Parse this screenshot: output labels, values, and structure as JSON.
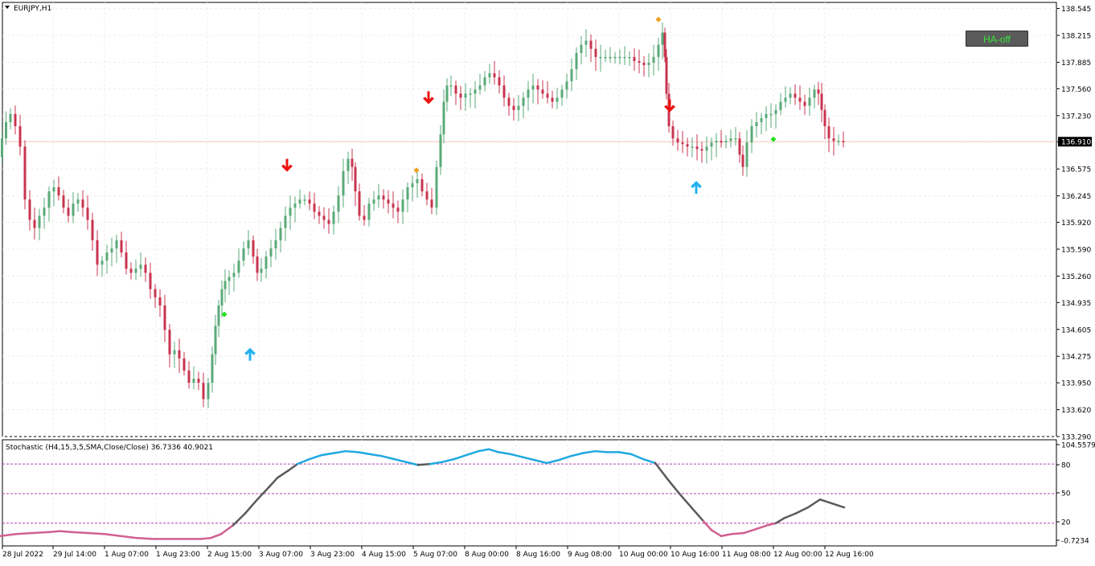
{
  "window": {
    "title": "EURJPY,H1"
  },
  "button": {
    "ha_label": "HA-off"
  },
  "colors": {
    "bull": "#5aaa78",
    "bear": "#c8344f",
    "grid": "#ececec",
    "stoch_high": "#20a8e0",
    "stoch_mid": "#5a5a5a",
    "stoch_low": "#d06090",
    "level_line": "#b040b0",
    "arrow_up": "#20b0f0",
    "arrow_down": "#ee1010",
    "dot_orange": "#f0a020",
    "dot_green": "#20e020",
    "price_marker_bg": "#000000",
    "price_marker_text": "#ffffff",
    "button_bg": "#5a5a5a",
    "button_text": "#39e639"
  },
  "chart_data": [
    {
      "type": "candlestick",
      "title": "EURJPY,H1",
      "ylim": [
        133.29,
        138.62
      ],
      "y_ticks": [
        "138.545",
        "138.215",
        "137.885",
        "137.560",
        "137.230",
        "136.910",
        "136.575",
        "136.245",
        "135.920",
        "135.590",
        "135.260",
        "134.935",
        "134.605",
        "134.275",
        "133.950",
        "133.620",
        "133.290"
      ],
      "current_price": "136.910",
      "x_ticks": [
        "28 Jul 2022",
        "29 Jul 14:00",
        "1 Aug 07:00",
        "1 Aug 23:00",
        "2 Aug 15:00",
        "3 Aug 07:00",
        "3 Aug 23:00",
        "4 Aug 15:00",
        "5 Aug 07:00",
        "8 Aug 00:00",
        "8 Aug 16:00",
        "9 Aug 08:00",
        "10 Aug 00:00",
        "10 Aug 16:00",
        "11 Aug 08:00",
        "12 Aug 00:00",
        "12 Aug 16:00"
      ],
      "close_path": [
        [
          0,
          136.72
        ],
        [
          5,
          136.95
        ],
        [
          10,
          137.15
        ],
        [
          16,
          137.25
        ],
        [
          22,
          137.1
        ],
        [
          28,
          136.85
        ],
        [
          34,
          136.2
        ],
        [
          40,
          135.95
        ],
        [
          46,
          135.85
        ],
        [
          52,
          136.0
        ],
        [
          58,
          136.1
        ],
        [
          64,
          136.3
        ],
        [
          70,
          136.35
        ],
        [
          76,
          136.25
        ],
        [
          82,
          136.1
        ],
        [
          88,
          136.0
        ],
        [
          94,
          136.15
        ],
        [
          100,
          136.2
        ],
        [
          106,
          136.1
        ],
        [
          112,
          135.95
        ],
        [
          118,
          135.7
        ],
        [
          124,
          135.4
        ],
        [
          130,
          135.45
        ],
        [
          136,
          135.55
        ],
        [
          142,
          135.6
        ],
        [
          148,
          135.7
        ],
        [
          154,
          135.55
        ],
        [
          160,
          135.35
        ],
        [
          166,
          135.3
        ],
        [
          172,
          135.35
        ],
        [
          178,
          135.4
        ],
        [
          184,
          135.3
        ],
        [
          190,
          135.1
        ],
        [
          196,
          135.0
        ],
        [
          202,
          134.9
        ],
        [
          208,
          134.6
        ],
        [
          214,
          134.3
        ],
        [
          220,
          134.35
        ],
        [
          226,
          134.25
        ],
        [
          232,
          134.1
        ],
        [
          238,
          133.95
        ],
        [
          244,
          134.0
        ],
        [
          250,
          133.95
        ],
        [
          256,
          133.75
        ],
        [
          262,
          133.95
        ],
        [
          266,
          134.3
        ],
        [
          270,
          134.65
        ],
        [
          274,
          134.9
        ],
        [
          278,
          135.1
        ],
        [
          282,
          135.2
        ],
        [
          288,
          135.25
        ],
        [
          294,
          135.3
        ],
        [
          300,
          135.45
        ],
        [
          306,
          135.6
        ],
        [
          312,
          135.7
        ],
        [
          318,
          135.5
        ],
        [
          322,
          135.3
        ],
        [
          328,
          135.35
        ],
        [
          334,
          135.5
        ],
        [
          340,
          135.6
        ],
        [
          346,
          135.7
        ],
        [
          352,
          135.85
        ],
        [
          358,
          136.0
        ],
        [
          364,
          136.1
        ],
        [
          370,
          136.15
        ],
        [
          376,
          136.2
        ],
        [
          382,
          136.2
        ],
        [
          388,
          136.15
        ],
        [
          394,
          136.05
        ],
        [
          400,
          136.0
        ],
        [
          406,
          135.95
        ],
        [
          412,
          135.9
        ],
        [
          418,
          136.05
        ],
        [
          424,
          136.25
        ],
        [
          430,
          136.55
        ],
        [
          436,
          136.7
        ],
        [
          440,
          136.6
        ],
        [
          444,
          136.3
        ],
        [
          450,
          136.0
        ],
        [
          456,
          135.95
        ],
        [
          462,
          136.15
        ],
        [
          468,
          136.2
        ],
        [
          474,
          136.25
        ],
        [
          480,
          136.2
        ],
        [
          486,
          136.15
        ],
        [
          492,
          136.1
        ],
        [
          498,
          136.05
        ],
        [
          504,
          136.2
        ],
        [
          510,
          136.35
        ],
        [
          516,
          136.4
        ],
        [
          522,
          136.45
        ],
        [
          528,
          136.3
        ],
        [
          534,
          136.2
        ],
        [
          540,
          136.1
        ],
        [
          546,
          136.6
        ],
        [
          550,
          137.0
        ],
        [
          554,
          137.4
        ],
        [
          558,
          137.6
        ],
        [
          564,
          137.6
        ],
        [
          570,
          137.5
        ],
        [
          576,
          137.45
        ],
        [
          582,
          137.5
        ],
        [
          588,
          137.5
        ],
        [
          594,
          137.55
        ],
        [
          600,
          137.6
        ],
        [
          606,
          137.7
        ],
        [
          612,
          137.75
        ],
        [
          618,
          137.7
        ],
        [
          624,
          137.6
        ],
        [
          630,
          137.45
        ],
        [
          636,
          137.35
        ],
        [
          642,
          137.3
        ],
        [
          648,
          137.35
        ],
        [
          654,
          137.45
        ],
        [
          660,
          137.55
        ],
        [
          666,
          137.6
        ],
        [
          672,
          137.55
        ],
        [
          678,
          137.5
        ],
        [
          684,
          137.45
        ],
        [
          690,
          137.4
        ],
        [
          696,
          137.45
        ],
        [
          702,
          137.55
        ],
        [
          708,
          137.65
        ],
        [
          714,
          137.8
        ],
        [
          720,
          138.0
        ],
        [
          726,
          138.1
        ],
        [
          732,
          138.15
        ],
        [
          738,
          138.05
        ],
        [
          744,
          137.95
        ],
        [
          750,
          137.95
        ],
        [
          756,
          137.95
        ],
        [
          762,
          137.95
        ],
        [
          768,
          137.95
        ],
        [
          774,
          137.95
        ],
        [
          780,
          137.95
        ],
        [
          786,
          137.95
        ],
        [
          792,
          137.9
        ],
        [
          798,
          137.88
        ],
        [
          804,
          137.85
        ],
        [
          810,
          137.88
        ],
        [
          816,
          137.95
        ],
        [
          822,
          138.1
        ],
        [
          826,
          138.25
        ],
        [
          828,
          137.95
        ],
        [
          830,
          137.5
        ],
        [
          834,
          137.1
        ],
        [
          840,
          136.95
        ],
        [
          846,
          136.9
        ],
        [
          852,
          136.88
        ],
        [
          858,
          136.85
        ],
        [
          864,
          136.85
        ],
        [
          870,
          136.82
        ],
        [
          876,
          136.8
        ],
        [
          882,
          136.85
        ],
        [
          888,
          136.9
        ],
        [
          894,
          136.92
        ],
        [
          900,
          136.9
        ],
        [
          906,
          136.92
        ],
        [
          912,
          136.95
        ],
        [
          918,
          136.95
        ],
        [
          922,
          136.75
        ],
        [
          926,
          136.6
        ],
        [
          932,
          136.9
        ],
        [
          938,
          137.1
        ],
        [
          944,
          137.15
        ],
        [
          950,
          137.2
        ],
        [
          956,
          137.25
        ],
        [
          962,
          137.25
        ],
        [
          968,
          137.3
        ],
        [
          974,
          137.4
        ],
        [
          980,
          137.45
        ],
        [
          986,
          137.5
        ],
        [
          992,
          137.45
        ],
        [
          998,
          137.4
        ],
        [
          1004,
          137.35
        ],
        [
          1010,
          137.45
        ],
        [
          1016,
          137.55
        ],
        [
          1020,
          137.5
        ],
        [
          1024,
          137.3
        ],
        [
          1028,
          137.1
        ],
        [
          1034,
          136.95
        ],
        [
          1040,
          136.92
        ],
        [
          1046,
          136.92
        ],
        [
          1052,
          136.91
        ]
      ],
      "markers": [
        {
          "type": "arrow-up",
          "x": 311,
          "price": 134.3
        },
        {
          "type": "arrow-up",
          "x": 866,
          "price": 136.35
        },
        {
          "type": "arrow-down",
          "x": 357,
          "price": 136.62
        },
        {
          "type": "arrow-down",
          "x": 533,
          "price": 137.45
        },
        {
          "type": "arrow-down",
          "x": 833,
          "price": 137.35
        },
        {
          "type": "dot-orange",
          "x": 518,
          "price": 136.56
        },
        {
          "type": "dot-orange",
          "x": 819,
          "price": 138.41
        },
        {
          "type": "dot-green",
          "x": 279,
          "price": 134.79
        },
        {
          "type": "dot-green",
          "x": 962,
          "price": 136.94
        }
      ]
    },
    {
      "type": "line",
      "title": "Stochastic (H4,15,3,5,SMA,Close/Close) 36.7336 40.9021",
      "ylim": [
        -3,
        104.5579
      ],
      "y_ticks": [
        "104.5579",
        "80",
        "50",
        "20",
        "-0.7234"
      ],
      "levels": [
        80,
        50,
        20
      ],
      "x": [
        0,
        20,
        40,
        60,
        75,
        90,
        110,
        130,
        150,
        170,
        190,
        210,
        230,
        250,
        262,
        275,
        290,
        305,
        320,
        335,
        345,
        358,
        370,
        385,
        400,
        415,
        430,
        445,
        460,
        475,
        490,
        505,
        520,
        535,
        550,
        565,
        580,
        595,
        608,
        620,
        635,
        650,
        665,
        680,
        695,
        710,
        725,
        740,
        755,
        770,
        785,
        800,
        815,
        830,
        845,
        860,
        875,
        885,
        897,
        910,
        925,
        940,
        955,
        965,
        975,
        990,
        1005,
        1020,
        1035,
        1050
      ],
      "values": [
        7,
        9,
        10,
        11,
        12,
        11,
        10,
        9,
        7,
        5,
        4,
        4,
        4,
        4,
        5,
        9,
        18,
        30,
        44,
        57,
        66,
        73,
        80,
        85,
        89,
        91,
        93,
        92,
        90,
        88,
        85,
        82,
        79,
        80,
        82,
        85,
        89,
        93,
        95,
        92,
        90,
        87,
        84,
        81,
        84,
        88,
        91,
        93,
        92,
        92,
        90,
        85,
        81,
        65,
        50,
        36,
        22,
        13,
        7,
        9,
        10,
        14,
        18,
        20,
        25,
        30,
        36,
        44,
        40,
        36
      ]
    }
  ]
}
